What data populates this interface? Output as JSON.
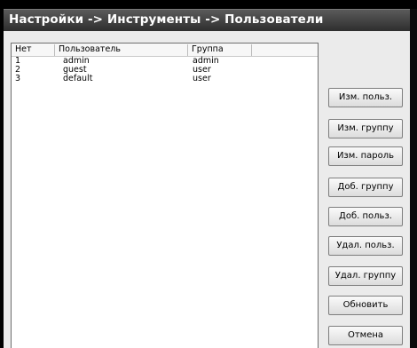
{
  "window": {
    "title": "Настройки -> Инструменты -> Пользователи"
  },
  "user_list": {
    "columns": [
      "Нет",
      "Пользователь",
      "Группа"
    ],
    "rows": [
      {
        "id": "1",
        "user": "admin",
        "group": "admin"
      },
      {
        "id": "2",
        "user": "guest",
        "group": "user"
      },
      {
        "id": "3",
        "user": "default",
        "group": "user"
      }
    ]
  },
  "actions": {
    "edit_user": "Изм. польз.",
    "edit_group": "Изм. группу",
    "edit_password": "Изм. пароль",
    "add_group": "Доб. группу",
    "add_user": "Доб. польз.",
    "delete_user": "Удал. польз.",
    "delete_group": "Удал. группу",
    "refresh": "Обновить",
    "cancel": "Отмена"
  },
  "colors": {
    "background": "#000000",
    "panel": "#ebebeb",
    "titlebar": "#3c3c3c"
  }
}
